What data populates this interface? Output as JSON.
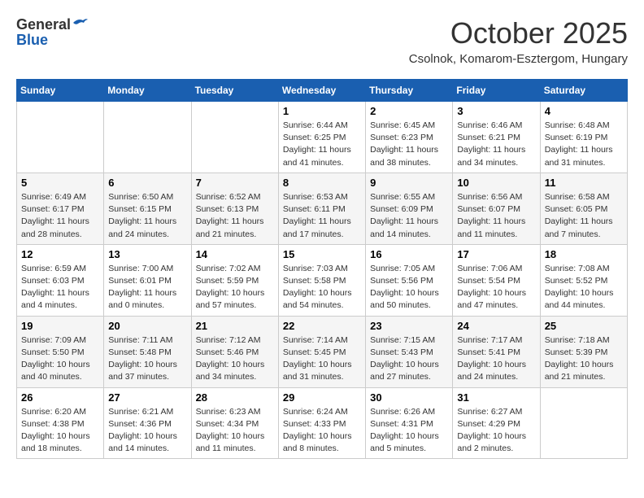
{
  "logo": {
    "general": "General",
    "blue": "Blue"
  },
  "title": "October 2025",
  "location": "Csolnok, Komarom-Esztergom, Hungary",
  "headers": [
    "Sunday",
    "Monday",
    "Tuesday",
    "Wednesday",
    "Thursday",
    "Friday",
    "Saturday"
  ],
  "weeks": [
    [
      {
        "num": "",
        "info": ""
      },
      {
        "num": "",
        "info": ""
      },
      {
        "num": "",
        "info": ""
      },
      {
        "num": "1",
        "info": "Sunrise: 6:44 AM\nSunset: 6:25 PM\nDaylight: 11 hours\nand 41 minutes."
      },
      {
        "num": "2",
        "info": "Sunrise: 6:45 AM\nSunset: 6:23 PM\nDaylight: 11 hours\nand 38 minutes."
      },
      {
        "num": "3",
        "info": "Sunrise: 6:46 AM\nSunset: 6:21 PM\nDaylight: 11 hours\nand 34 minutes."
      },
      {
        "num": "4",
        "info": "Sunrise: 6:48 AM\nSunset: 6:19 PM\nDaylight: 11 hours\nand 31 minutes."
      }
    ],
    [
      {
        "num": "5",
        "info": "Sunrise: 6:49 AM\nSunset: 6:17 PM\nDaylight: 11 hours\nand 28 minutes."
      },
      {
        "num": "6",
        "info": "Sunrise: 6:50 AM\nSunset: 6:15 PM\nDaylight: 11 hours\nand 24 minutes."
      },
      {
        "num": "7",
        "info": "Sunrise: 6:52 AM\nSunset: 6:13 PM\nDaylight: 11 hours\nand 21 minutes."
      },
      {
        "num": "8",
        "info": "Sunrise: 6:53 AM\nSunset: 6:11 PM\nDaylight: 11 hours\nand 17 minutes."
      },
      {
        "num": "9",
        "info": "Sunrise: 6:55 AM\nSunset: 6:09 PM\nDaylight: 11 hours\nand 14 minutes."
      },
      {
        "num": "10",
        "info": "Sunrise: 6:56 AM\nSunset: 6:07 PM\nDaylight: 11 hours\nand 11 minutes."
      },
      {
        "num": "11",
        "info": "Sunrise: 6:58 AM\nSunset: 6:05 PM\nDaylight: 11 hours\nand 7 minutes."
      }
    ],
    [
      {
        "num": "12",
        "info": "Sunrise: 6:59 AM\nSunset: 6:03 PM\nDaylight: 11 hours\nand 4 minutes."
      },
      {
        "num": "13",
        "info": "Sunrise: 7:00 AM\nSunset: 6:01 PM\nDaylight: 11 hours\nand 0 minutes."
      },
      {
        "num": "14",
        "info": "Sunrise: 7:02 AM\nSunset: 5:59 PM\nDaylight: 10 hours\nand 57 minutes."
      },
      {
        "num": "15",
        "info": "Sunrise: 7:03 AM\nSunset: 5:58 PM\nDaylight: 10 hours\nand 54 minutes."
      },
      {
        "num": "16",
        "info": "Sunrise: 7:05 AM\nSunset: 5:56 PM\nDaylight: 10 hours\nand 50 minutes."
      },
      {
        "num": "17",
        "info": "Sunrise: 7:06 AM\nSunset: 5:54 PM\nDaylight: 10 hours\nand 47 minutes."
      },
      {
        "num": "18",
        "info": "Sunrise: 7:08 AM\nSunset: 5:52 PM\nDaylight: 10 hours\nand 44 minutes."
      }
    ],
    [
      {
        "num": "19",
        "info": "Sunrise: 7:09 AM\nSunset: 5:50 PM\nDaylight: 10 hours\nand 40 minutes."
      },
      {
        "num": "20",
        "info": "Sunrise: 7:11 AM\nSunset: 5:48 PM\nDaylight: 10 hours\nand 37 minutes."
      },
      {
        "num": "21",
        "info": "Sunrise: 7:12 AM\nSunset: 5:46 PM\nDaylight: 10 hours\nand 34 minutes."
      },
      {
        "num": "22",
        "info": "Sunrise: 7:14 AM\nSunset: 5:45 PM\nDaylight: 10 hours\nand 31 minutes."
      },
      {
        "num": "23",
        "info": "Sunrise: 7:15 AM\nSunset: 5:43 PM\nDaylight: 10 hours\nand 27 minutes."
      },
      {
        "num": "24",
        "info": "Sunrise: 7:17 AM\nSunset: 5:41 PM\nDaylight: 10 hours\nand 24 minutes."
      },
      {
        "num": "25",
        "info": "Sunrise: 7:18 AM\nSunset: 5:39 PM\nDaylight: 10 hours\nand 21 minutes."
      }
    ],
    [
      {
        "num": "26",
        "info": "Sunrise: 6:20 AM\nSunset: 4:38 PM\nDaylight: 10 hours\nand 18 minutes."
      },
      {
        "num": "27",
        "info": "Sunrise: 6:21 AM\nSunset: 4:36 PM\nDaylight: 10 hours\nand 14 minutes."
      },
      {
        "num": "28",
        "info": "Sunrise: 6:23 AM\nSunset: 4:34 PM\nDaylight: 10 hours\nand 11 minutes."
      },
      {
        "num": "29",
        "info": "Sunrise: 6:24 AM\nSunset: 4:33 PM\nDaylight: 10 hours\nand 8 minutes."
      },
      {
        "num": "30",
        "info": "Sunrise: 6:26 AM\nSunset: 4:31 PM\nDaylight: 10 hours\nand 5 minutes."
      },
      {
        "num": "31",
        "info": "Sunrise: 6:27 AM\nSunset: 4:29 PM\nDaylight: 10 hours\nand 2 minutes."
      },
      {
        "num": "",
        "info": ""
      }
    ]
  ]
}
